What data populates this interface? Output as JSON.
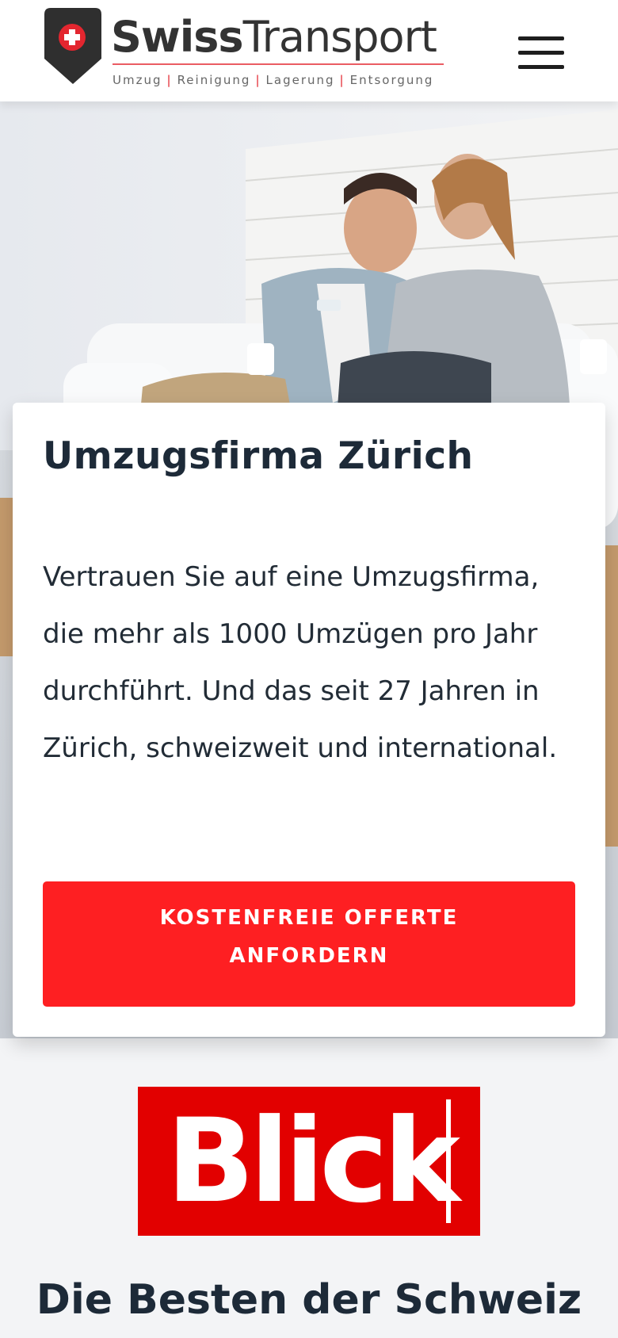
{
  "header": {
    "brand_bold": "Swiss",
    "brand_light": "Transport",
    "tagline": [
      "Umzug",
      "Reinigung",
      "Lagerung",
      "Entsorgung"
    ],
    "tagline_separator": "|",
    "menu_icon": "hamburger-menu-icon",
    "logo_icon": "shield-swiss-cross-icon"
  },
  "hero": {
    "title": "Umzugsfirma Zürich",
    "text": "Vertrauen Sie auf eine Umzugsfirma, die mehr als 1000 Umzügen pro Jahr durchführt. Und das seit 27 Jahren in Zürich, schweizweit und international.",
    "cta_label": "KOSTENFREIE OFFERTE ANFORDERN"
  },
  "press": {
    "logo_text": "Blick",
    "heading": "Die Besten der Schweiz"
  },
  "colors": {
    "accent_red": "#fe1f22",
    "blick_red": "#e20000",
    "text_dark": "#1d2a38"
  }
}
